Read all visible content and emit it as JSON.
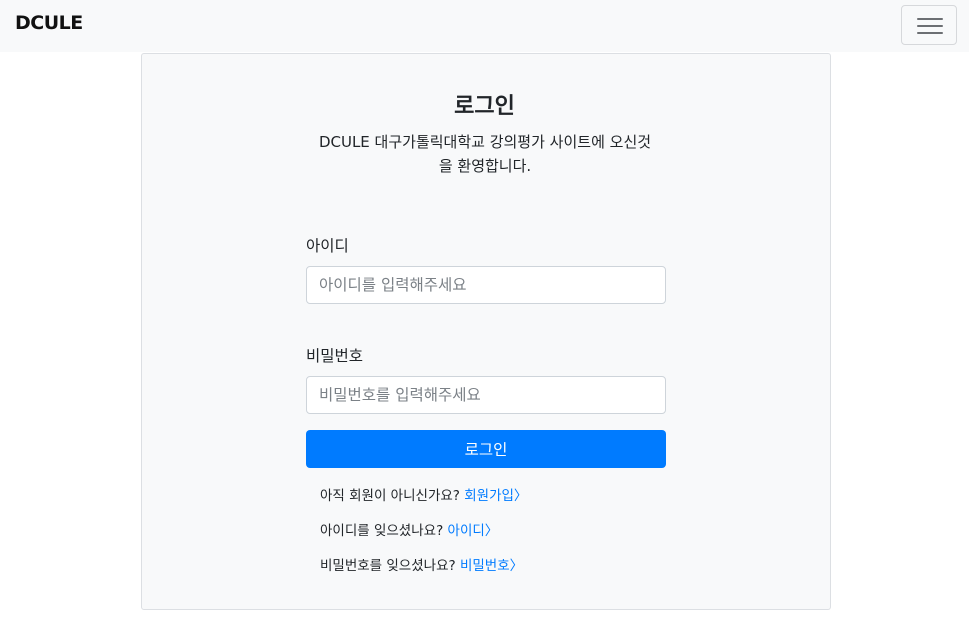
{
  "navbar": {
    "brand": "DCULE",
    "toggler_icon": "hamburger-menu-icon"
  },
  "login": {
    "title": "로그인",
    "subtitle_line1": "DCULE 대구가톨릭대학교 강의평가 사이트에 오신것",
    "subtitle_line2": "을 환영합니다.",
    "id_label": "아이디",
    "id_placeholder": "아이디를 입력해주세요",
    "pw_label": "비밀번호",
    "pw_placeholder": "비밀번호를 입력해주세요",
    "submit_label": "로그인"
  },
  "help": {
    "signup_text": "아직 회원이 아니신가요? ",
    "signup_link": "회원가입〉",
    "find_id_text": "아이디를 잊으셨나요? ",
    "find_id_link": "아이디〉",
    "find_pw_text": "비밀번호를 잊으셨나요? ",
    "find_pw_link": "비밀번호〉"
  },
  "colors": {
    "primary": "#007bff",
    "card_bg": "#f8f9fa",
    "navbar_bg": "#f8f9fa"
  }
}
